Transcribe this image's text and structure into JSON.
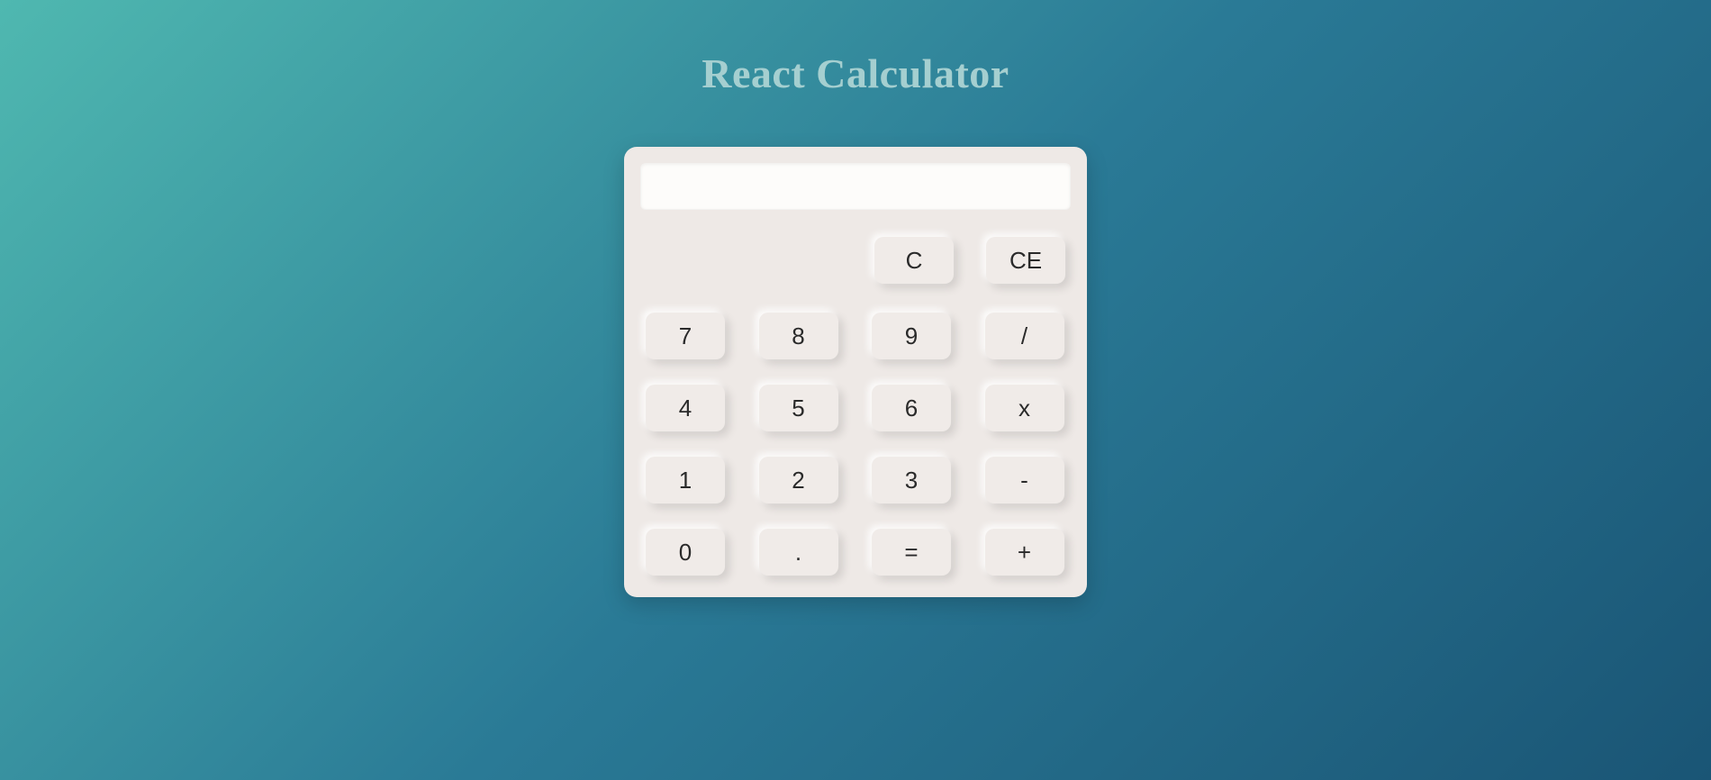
{
  "title": "React Calculator",
  "display": "",
  "clearButtons": {
    "clear": "C",
    "clearEntry": "CE"
  },
  "buttons": {
    "row1": [
      "7",
      "8",
      "9",
      "/"
    ],
    "row2": [
      "4",
      "5",
      "6",
      "x"
    ],
    "row3": [
      "1",
      "2",
      "3",
      "-"
    ],
    "row4": [
      "0",
      ".",
      "=",
      "+"
    ]
  }
}
